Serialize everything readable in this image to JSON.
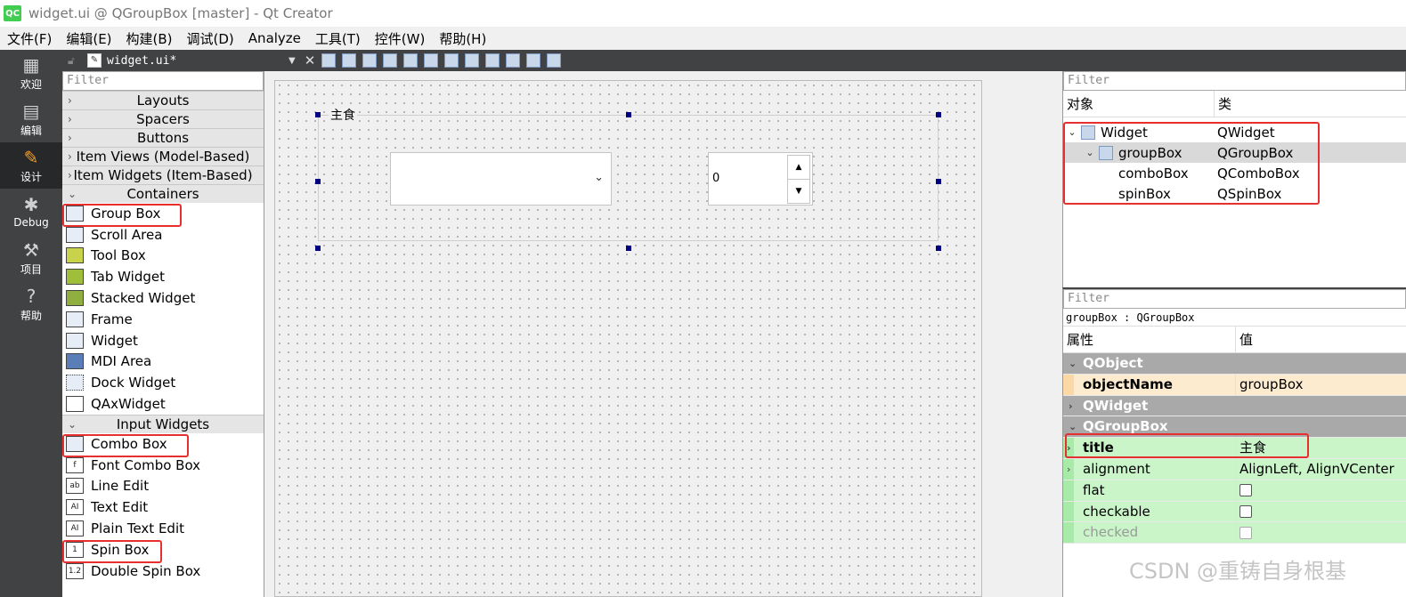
{
  "window": {
    "title": "widget.ui @ QGroupBox [master] - Qt Creator",
    "logo": "QC"
  },
  "menubar": [
    "文件(F)",
    "编辑(E)",
    "构建(B)",
    "调试(D)",
    "Analyze",
    "工具(T)",
    "控件(W)",
    "帮助(H)"
  ],
  "modes": [
    {
      "label": "欢迎",
      "icon": "grid-icon",
      "glyph": "▦"
    },
    {
      "label": "编辑",
      "icon": "document-icon",
      "glyph": "▤"
    },
    {
      "label": "设计",
      "icon": "pencil-icon",
      "glyph": "✎"
    },
    {
      "label": "Debug",
      "icon": "bug-icon",
      "glyph": "✱"
    },
    {
      "label": "项目",
      "icon": "wrench-icon",
      "glyph": "⚒"
    },
    {
      "label": "帮助",
      "icon": "help-icon",
      "glyph": "?"
    }
  ],
  "editor": {
    "filename": "widget.ui*"
  },
  "widgetbox": {
    "filter_placeholder": "Filter",
    "categories_top": [
      "Layouts",
      "Spacers",
      "Buttons",
      "Item Views (Model-Based)",
      "Item Widgets (Item-Based)",
      "Containers"
    ],
    "containers": [
      "Group Box",
      "Scroll Area",
      "Tool Box",
      "Tab Widget",
      "Stacked Widget",
      "Frame",
      "Widget",
      "MDI Area",
      "Dock Widget",
      "QAxWidget"
    ],
    "input_category": "Input Widgets",
    "inputs": [
      "Combo Box",
      "Font Combo Box",
      "Line Edit",
      "Text Edit",
      "Plain Text Edit",
      "Spin Box",
      "Double Spin Box"
    ]
  },
  "form": {
    "groupbox_title": "主食",
    "spinbox_value": "0"
  },
  "object_inspector": {
    "filter_placeholder": "Filter",
    "col_object": "对象",
    "col_class": "类",
    "rows": [
      {
        "name": "Widget",
        "cls": "QWidget"
      },
      {
        "name": "groupBox",
        "cls": "QGroupBox"
      },
      {
        "name": "comboBox",
        "cls": "QComboBox"
      },
      {
        "name": "spinBox",
        "cls": "QSpinBox"
      }
    ]
  },
  "property_editor": {
    "filter_placeholder": "Filter",
    "object_label": "groupBox : QGroupBox",
    "col_property": "属性",
    "col_value": "值",
    "sect_qobject": "QObject",
    "objectName_label": "objectName",
    "objectName_value": "groupBox",
    "sect_qwidget": "QWidget",
    "sect_qgroupbox": "QGroupBox",
    "title_label": "title",
    "title_value": "主食",
    "alignment_label": "alignment",
    "alignment_value": "AlignLeft, AlignVCenter",
    "flat_label": "flat",
    "checkable_label": "checkable",
    "checked_label": "checked"
  },
  "watermark": "CSDN @重铸自身根基"
}
